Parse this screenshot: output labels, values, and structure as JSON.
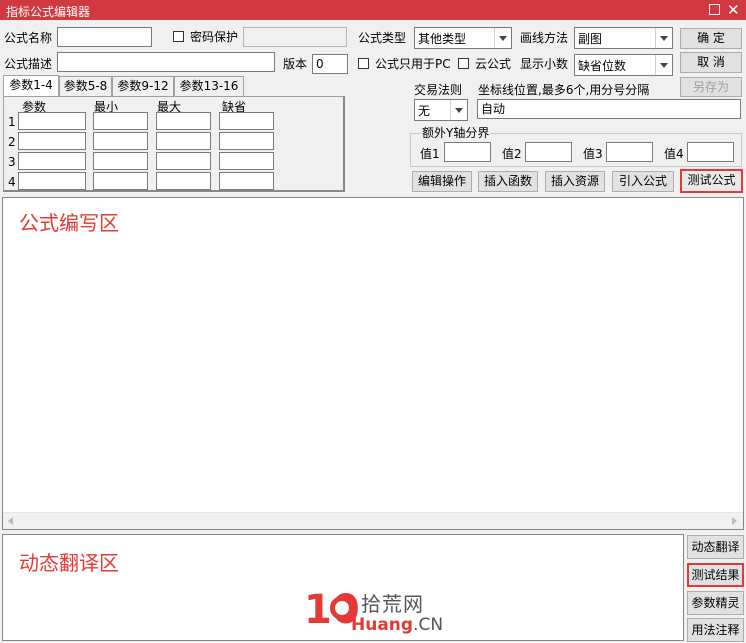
{
  "window": {
    "title": "指标公式编辑器"
  },
  "labels": {
    "name": "公式名称",
    "password": "密码保护",
    "desc": "公式描述",
    "version": "版本",
    "type": "公式类型",
    "draw": "画线方法",
    "pc_only": "公式只用于PC",
    "cloud": "云公式",
    "decimals": "显示小数",
    "trade_rule": "交易法则",
    "coord_hint": "坐标线位置,最多6个,用分号分隔",
    "y_group": "额外Y轴分界"
  },
  "fields": {
    "name": "",
    "password": "",
    "desc": "",
    "version": "0",
    "coord": "自动",
    "y1": "",
    "y2": "",
    "y3": "",
    "y4": ""
  },
  "selects": {
    "type": "其他类型",
    "draw": "副图",
    "decimals": "缺省位数",
    "trade_rule": "无"
  },
  "y_labels": {
    "v1": "值1",
    "v2": "值2",
    "v3": "值3",
    "v4": "值4"
  },
  "buttons": {
    "ok": "确  定",
    "cancel": "取  消",
    "save_as": "另存为",
    "edit_ops": "编辑操作",
    "insert_func": "插入函数",
    "insert_res": "插入资源",
    "import_formula": "引入公式",
    "test_formula": "测试公式"
  },
  "tabs": [
    "参数1-4",
    "参数5-8",
    "参数9-12",
    "参数13-16"
  ],
  "params": {
    "headers": {
      "param": "参数",
      "min": "最小",
      "max": "最大",
      "default": "缺省"
    },
    "rows": [
      "1",
      "2",
      "3",
      "4"
    ]
  },
  "annotations": {
    "editor": "公式编写区",
    "translate": "动态翻译区"
  },
  "side_buttons": [
    "动态翻译",
    "测试结果",
    "参数精灵",
    "用法注释"
  ],
  "watermark": {
    "num": "10",
    "cn": "拾荒网",
    "en_a": "Huang",
    "en_b": ".CN"
  }
}
